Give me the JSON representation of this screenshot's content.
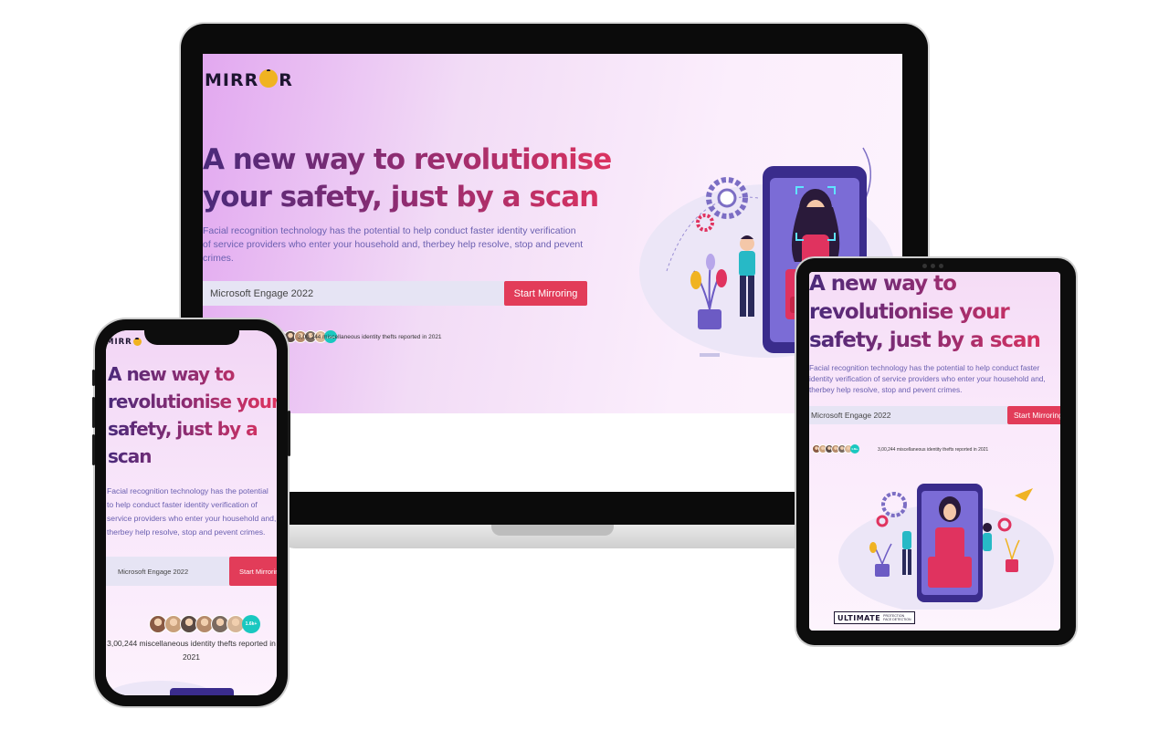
{
  "brand": {
    "logo_text_left": "MIRR",
    "logo_text_right": "R",
    "logo_icon": "lock-icon"
  },
  "hero": {
    "headline": "A new way to revolutionise your safety, just by a scan",
    "headline_laptop_line1": "A new way to revolutionise",
    "headline_laptop_line2": "your safety, just by a scan",
    "headline_tablet_line1": "A new way to",
    "headline_tablet_line2": "revolutionise your",
    "headline_tablet_line3": "safety, just by a scan",
    "headline_phone_line1": "A new way to",
    "headline_phone_line2": "revolutionise your",
    "headline_phone_line3": "safety, just by a",
    "headline_phone_line4": "scan",
    "description": "Facial recognition technology has the potential to help conduct faster identity verification of service providers who enter your household and, therbey help resolve, stop and pevent crimes."
  },
  "search": {
    "value": "Microsoft Engage 2022",
    "button_label": "Start Mirroring"
  },
  "stats": {
    "avatar_count_badge": "1.6k+",
    "text": "3,00,244 miscellaneous identity thefts reported in 2021"
  },
  "badge": {
    "title": "ULTIMATE",
    "subtitle_line1": "PROTECTION",
    "subtitle_line2": "FACE DETECTION"
  },
  "colors": {
    "accent": "#e23c59",
    "headline_start": "#4a2a7a",
    "headline_end": "#e0335f",
    "teal": "#19c8c0",
    "logo_gold": "#f0b322"
  }
}
